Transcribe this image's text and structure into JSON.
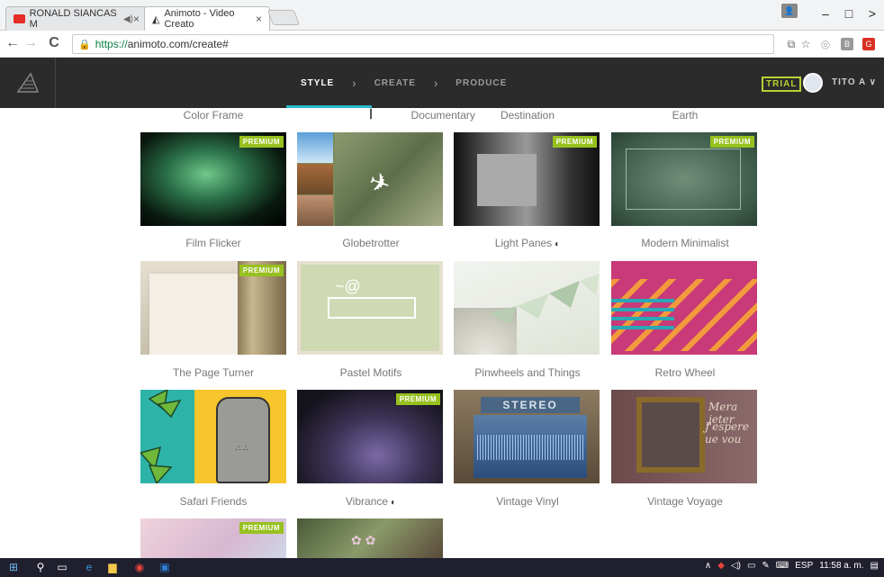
{
  "browser": {
    "tabs": [
      {
        "title": "RONALD SIANCAS M",
        "active": false
      },
      {
        "title": "Animoto - Video Creato",
        "active": true
      }
    ],
    "url_scheme": "https://",
    "url_rest": "animoto.com/create#",
    "nav": {
      "back": "←",
      "forward": "→",
      "reload": "C"
    },
    "window_controls": {
      "minimize": "–",
      "maximize": "□",
      "close": ">"
    }
  },
  "header": {
    "steps": [
      {
        "label": "STYLE",
        "active": true
      },
      {
        "label": "CREATE",
        "active": false
      },
      {
        "label": "PRODUCE",
        "active": false
      }
    ],
    "chevron": "›",
    "trial_badge": "TRIAL",
    "user_name": "TITO A",
    "user_chevron": "∨"
  },
  "styles": {
    "top_labels": [
      "Color Frame",
      "Documentary",
      "Destination",
      "Earth"
    ],
    "premium_label": "PREMIUM",
    "rows": [
      [
        {
          "name": "Film Flicker",
          "premium": true
        },
        {
          "name": "Globetrotter",
          "premium": false
        },
        {
          "name": "Light Panes",
          "premium": true,
          "has_icon": true
        },
        {
          "name": "Modern Minimalist",
          "premium": true
        }
      ],
      [
        {
          "name": "The Page Turner",
          "premium": true
        },
        {
          "name": "Pastel Motifs",
          "premium": false
        },
        {
          "name": "Pinwheels and Things",
          "premium": false
        },
        {
          "name": "Retro Wheel",
          "premium": false
        }
      ],
      [
        {
          "name": "Safari Friends",
          "premium": false
        },
        {
          "name": "Vibrance",
          "premium": true,
          "has_icon": true
        },
        {
          "name": "Vintage Vinyl",
          "premium": false
        },
        {
          "name": "Vintage Voyage",
          "premium": false
        }
      ],
      [
        {
          "name": "",
          "premium": true
        },
        {
          "name": "",
          "premium": false
        }
      ]
    ],
    "stereo_text": "STEREO",
    "voyage_text_1": "Mera  jeter",
    "voyage_text_2": "J'espere  ue vou",
    "documentary_icon": "!!!"
  },
  "taskbar": {
    "language": "ESP",
    "time": "11:58 a. m."
  },
  "colors": {
    "accent": "#27b8cc",
    "premium": "#97c11f",
    "trial": "#b3d233",
    "header_bg": "#2b2b2b"
  }
}
